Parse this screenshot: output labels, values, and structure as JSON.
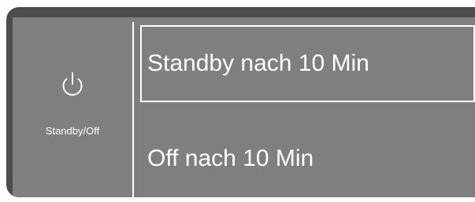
{
  "sidebar": {
    "icon": "power-icon",
    "label": "Standby/Off"
  },
  "options": [
    {
      "label": "Standby nach 10 Min",
      "selected": true
    },
    {
      "label": "Off nach 10 Min",
      "selected": false
    }
  ],
  "colors": {
    "frame": "#4d4d4d",
    "panel": "#7f7f7f",
    "text": "#ffffff"
  }
}
